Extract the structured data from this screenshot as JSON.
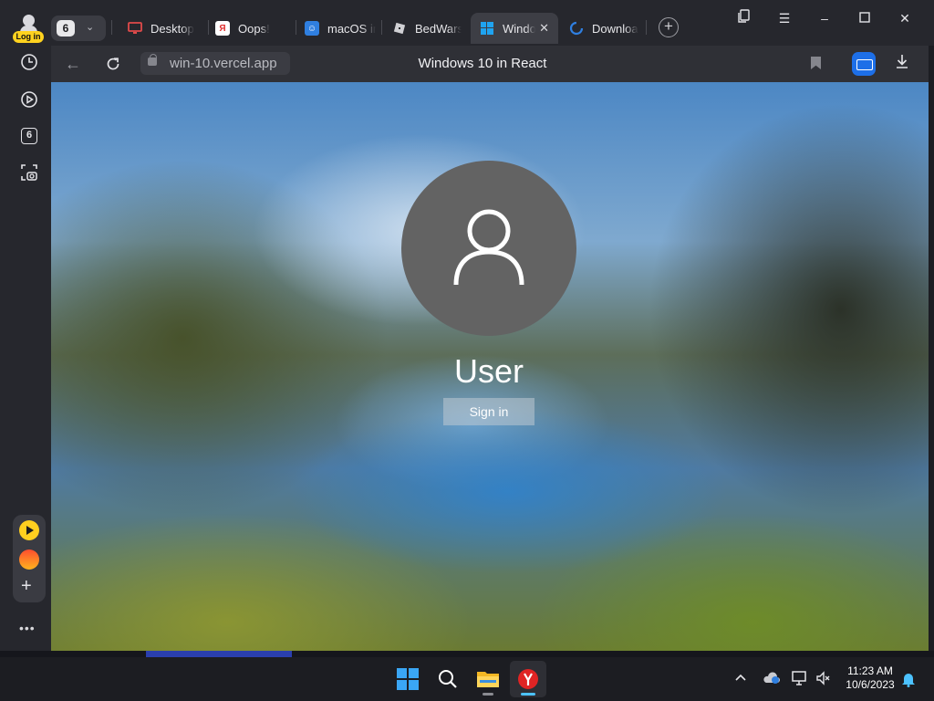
{
  "browser": {
    "login_label": "Log in",
    "tab_count": "6",
    "tabs": [
      {
        "title": "Desktop",
        "icon": "monitor-icon",
        "color": "#e04040"
      },
      {
        "title": "Oops!",
        "icon": "yandex-icon",
        "color": "#e03030"
      },
      {
        "title": "macOS in",
        "icon": "finder-icon",
        "color": "#2f7fe0"
      },
      {
        "title": "BedWars",
        "icon": "roblox-icon",
        "color": "#d0d0d4"
      },
      {
        "title": "Windo",
        "icon": "windows-icon",
        "color": "#1fa3f0",
        "active": true
      },
      {
        "title": "Downloa",
        "icon": "edge-loading-icon",
        "color": "#2f7fe0"
      }
    ],
    "address": {
      "url": "win-10.vercel.app",
      "page_title": "Windows 10 in React"
    },
    "sidebar": {
      "tabs_badge": "6",
      "more_label": "•••"
    }
  },
  "lockscreen": {
    "username": "User",
    "signin_label": "Sign in"
  },
  "taskbar": {
    "time": "11:23 AM",
    "date": "10/6/2023",
    "pinned": [
      "windows-start-icon",
      "search-icon",
      "file-explorer-icon",
      "yandex-browser-icon"
    ]
  }
}
